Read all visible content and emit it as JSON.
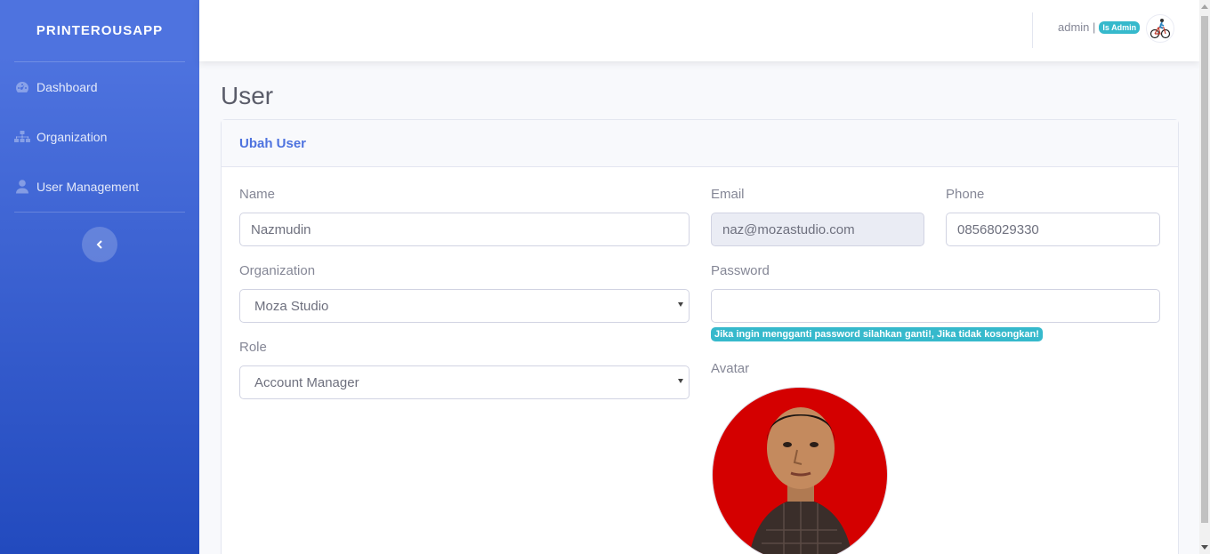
{
  "sidebar": {
    "brand": "PRINTEROUSAPP",
    "items": [
      {
        "label": "Dashboard",
        "icon": "tachometer-icon"
      },
      {
        "label": "Organization",
        "icon": "sitemap-icon"
      },
      {
        "label": "User Management",
        "icon": "user-icon"
      }
    ],
    "toggle_icon": "chevron-left-icon"
  },
  "topbar": {
    "username": "admin |",
    "role_badge": "Is Admin",
    "avatar_icon": "cyclist-avatar"
  },
  "page": {
    "title": "User",
    "card_title": "Ubah User"
  },
  "form": {
    "name": {
      "label": "Name",
      "value": "Nazmudin"
    },
    "email": {
      "label": "Email",
      "value": "naz@mozastudio.com"
    },
    "phone": {
      "label": "Phone",
      "value": "08568029330"
    },
    "organization": {
      "label": "Organization",
      "value": "Moza Studio"
    },
    "password": {
      "label": "Password",
      "value": "",
      "hint": "Jika ingin mengganti password silahkan ganti!, Jika tidak kosongkan!"
    },
    "role": {
      "label": "Role",
      "value": "Account Manager"
    },
    "avatar": {
      "label": "Avatar"
    }
  },
  "colors": {
    "primary": "#4e73df",
    "info": "#36b9cc",
    "avatar_background": "#d40000"
  }
}
